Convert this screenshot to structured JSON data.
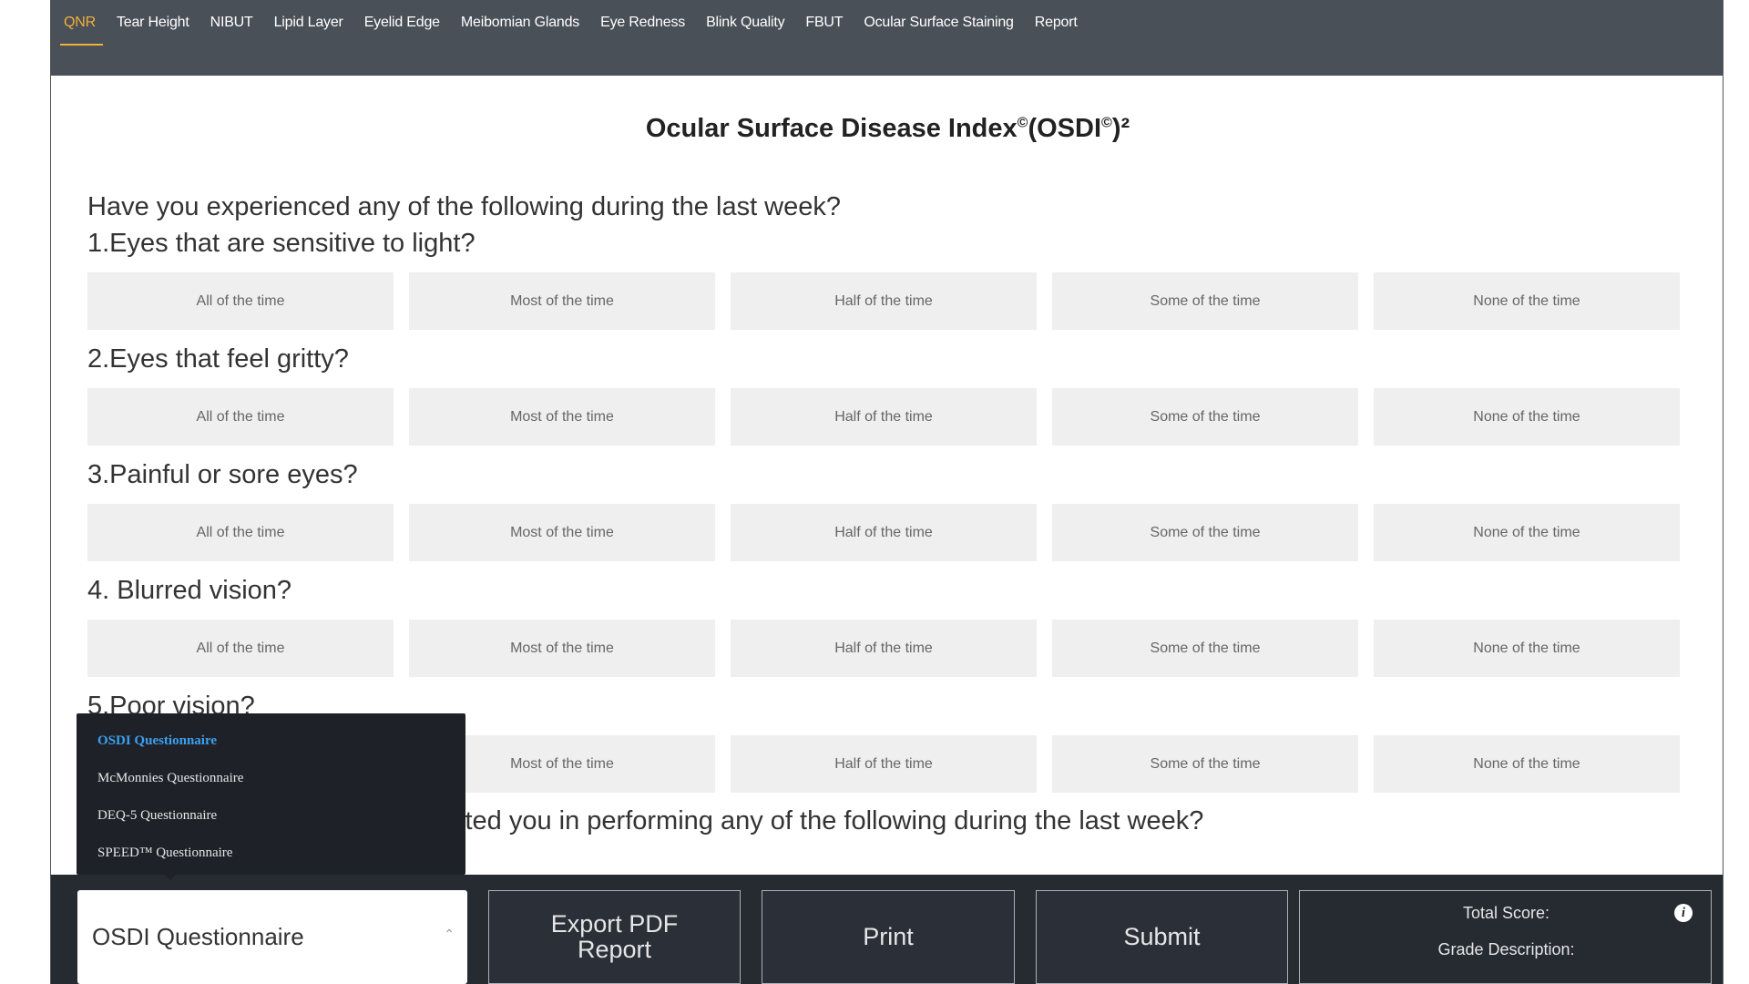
{
  "nav": {
    "tabs": [
      {
        "label": "QNR",
        "active": true
      },
      {
        "label": "Tear Height"
      },
      {
        "label": "NIBUT"
      },
      {
        "label": "Lipid Layer"
      },
      {
        "label": "Eyelid Edge"
      },
      {
        "label": "Meibomian Glands"
      },
      {
        "label": "Eye Redness"
      },
      {
        "label": "Blink Quality"
      },
      {
        "label": "FBUT"
      },
      {
        "label": "Ocular Surface Staining"
      },
      {
        "label": "Report"
      }
    ]
  },
  "form": {
    "title_main": "Ocular Surface Disease Index",
    "title_sup1": "©",
    "title_mid": "(OSDI",
    "title_sup2": "©",
    "title_end": ")²",
    "intro": "Have you experienced any of the following during the last week?",
    "questions": [
      "1.Eyes that are sensitive to light?",
      "2.Eyes that feel gritty?",
      "3.Painful or sore eyes?",
      "4. Blurred vision?",
      "5.Poor vision?"
    ],
    "options": [
      "All of the time",
      "Most of the time",
      "Half of the time",
      "Some of the time",
      "None of the time"
    ],
    "section2_partial": "limited you in performing any of the following during the last week?"
  },
  "dropdown": {
    "items": [
      "OSDI Questionnaire",
      "McMonnies Questionnaire",
      "DEQ-5 Questionnaire",
      "SPEED™ Questionnaire"
    ],
    "selected_index": 0
  },
  "bottom": {
    "select_value": "OSDI Questionnaire",
    "export_label_1": "Export PDF",
    "export_label_2": "Report",
    "print_label": "Print",
    "submit_label": "Submit",
    "total_score_label": "Total Score:",
    "grade_label": "Grade Description:"
  },
  "colors": {
    "nav_bg": "#4a5058",
    "active_tab": "#f0b13a",
    "option_bg": "#efefef",
    "bottom_bar": "#262a31",
    "menu_selected": "#3ca0f0"
  }
}
